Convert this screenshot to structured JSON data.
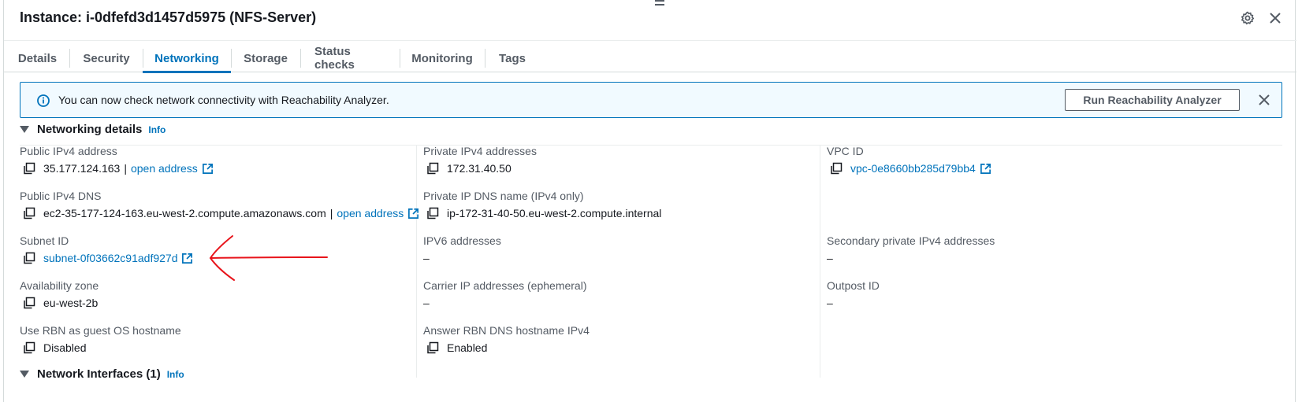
{
  "header": {
    "title": "Instance: i-0dfefd3d1457d5975 (NFS-Server)"
  },
  "tabs": [
    {
      "label": "Details",
      "active": false
    },
    {
      "label": "Security",
      "active": false
    },
    {
      "label": "Networking",
      "active": true
    },
    {
      "label": "Storage",
      "active": false
    },
    {
      "label": "Status checks",
      "active": false
    },
    {
      "label": "Monitoring",
      "active": false
    },
    {
      "label": "Tags",
      "active": false
    }
  ],
  "banner": {
    "text": "You can now check network connectivity with Reachability Analyzer.",
    "button_label": "Run Reachability Analyzer"
  },
  "networking_details": {
    "title": "Networking details",
    "info_label": "Info",
    "col1": {
      "public_ipv4": {
        "label": "Public IPv4 address",
        "value": "35.177.124.163",
        "link": "open address"
      },
      "public_dns": {
        "label": "Public IPv4 DNS",
        "value": "ec2-35-177-124-163.eu-west-2.compute.amazonaws.com",
        "link": "open address"
      },
      "subnet": {
        "label": "Subnet ID",
        "value": "subnet-0f03662c91adf927d"
      },
      "az": {
        "label": "Availability zone",
        "value": "eu-west-2b"
      },
      "rbn": {
        "label": "Use RBN as guest OS hostname",
        "value": "Disabled"
      }
    },
    "col2": {
      "private_ipv4": {
        "label": "Private IPv4 addresses",
        "value": "172.31.40.50"
      },
      "private_dns": {
        "label": "Private IP DNS name (IPv4 only)",
        "value": "ip-172-31-40-50.eu-west-2.compute.internal"
      },
      "ipv6": {
        "label": "IPV6 addresses",
        "value": "–"
      },
      "carrier": {
        "label": "Carrier IP addresses (ephemeral)",
        "value": "–"
      },
      "answer_rbn": {
        "label": "Answer RBN DNS hostname IPv4",
        "value": "Enabled"
      }
    },
    "col3": {
      "vpc": {
        "label": "VPC ID",
        "value": "vpc-0e8660bb285d79bb4"
      },
      "secondary": {
        "label": "Secondary private IPv4 addresses",
        "value": "–"
      },
      "outpost": {
        "label": "Outpost ID",
        "value": "–"
      }
    }
  },
  "network_interfaces": {
    "title": "Network Interfaces (1)",
    "info_label": "Info"
  },
  "colors": {
    "accent": "#0073bb",
    "annotation_arrow": "#e8141b"
  },
  "icons": [
    "gear-icon",
    "close-icon",
    "info-circle-icon",
    "copy-icon",
    "external-link-icon",
    "caret-down-icon"
  ]
}
